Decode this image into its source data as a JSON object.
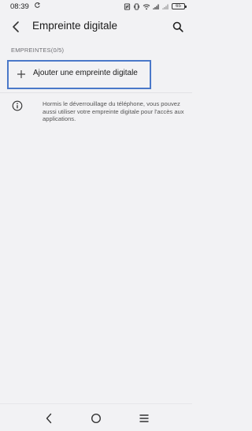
{
  "status_bar": {
    "time": "08:39",
    "battery_level": "65"
  },
  "app_bar": {
    "title": "Empreinte digitale",
    "back_icon": "chevron-left-icon",
    "search_icon": "search-icon"
  },
  "section": {
    "header": "EMPREINTES(0/5)"
  },
  "add_fingerprint": {
    "label": "Ajouter une empreinte digitale",
    "icon": "plus-icon",
    "highlight_color": "#4a78c9"
  },
  "info": {
    "icon": "info-icon",
    "text": "Hormis le déverrouillage du téléphone, vous pouvez aussi utiliser votre empreinte digitale pour l'accès aux applications."
  },
  "nav_bar": {
    "back_icon": "nav-back-icon",
    "home_icon": "nav-home-icon",
    "menu_icon": "nav-menu-icon"
  }
}
